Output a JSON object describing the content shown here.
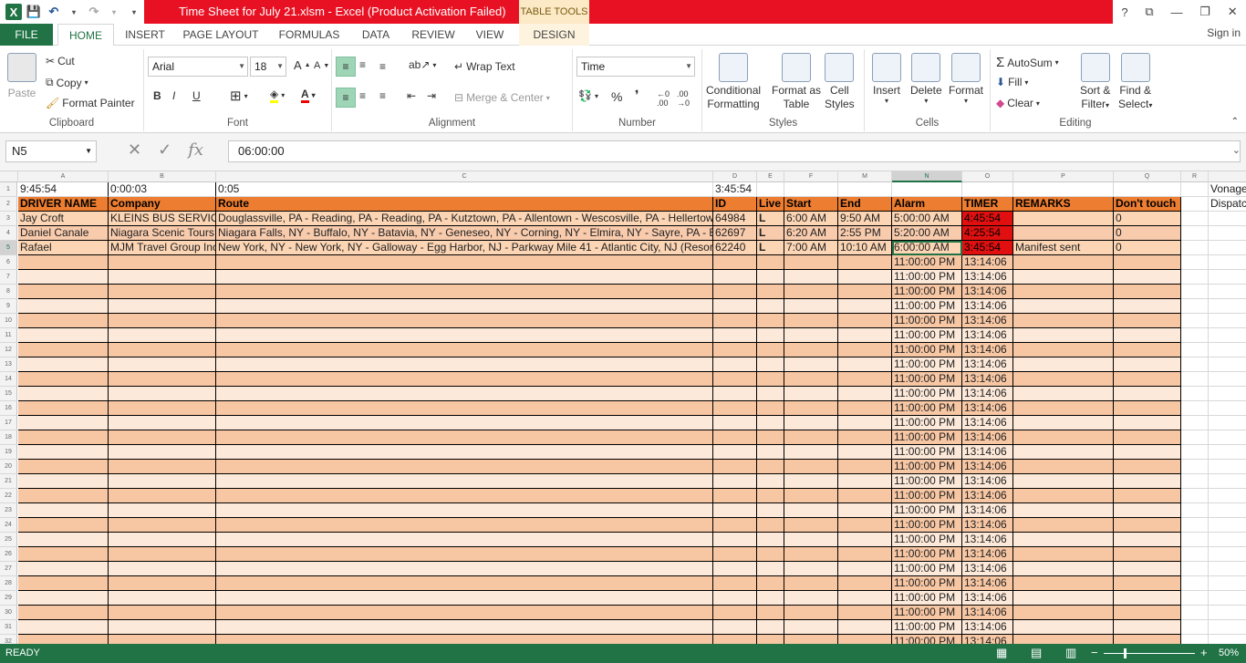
{
  "titlebar": {
    "title": "Time Sheet for July 21.xlsm -  Excel (Product Activation Failed)",
    "table_tools": "TABLE TOOLS",
    "help": "?",
    "restore_ribbon": "⧉",
    "minimize": "—",
    "maximize": "❐",
    "close": "✕"
  },
  "tabs": {
    "file": "FILE",
    "home": "HOME",
    "insert": "INSERT",
    "page_layout": "PAGE LAYOUT",
    "formulas": "FORMULAS",
    "data": "DATA",
    "review": "REVIEW",
    "view": "VIEW",
    "design": "DESIGN",
    "sign_in": "Sign in"
  },
  "ribbon": {
    "clipboard": {
      "paste": "Paste",
      "cut": "Cut",
      "copy": "Copy",
      "format_painter": "Format Painter",
      "title": "Clipboard"
    },
    "font": {
      "name": "Arial",
      "size": "18",
      "bold": "B",
      "italic": "I",
      "underline": "U",
      "title": "Font"
    },
    "alignment": {
      "wrap_text": "Wrap Text",
      "merge_center": "Merge & Center",
      "title": "Alignment"
    },
    "number": {
      "format": "Time",
      "percent": "%",
      "comma": "❜",
      "title": "Number"
    },
    "styles": {
      "conditional": "Conditional",
      "formatting": "Formatting",
      "format_as": "Format as",
      "table": "Table",
      "cell": "Cell",
      "styles_label": "Styles",
      "title": "Styles"
    },
    "cells": {
      "insert": "Insert",
      "delete": "Delete",
      "format": "Format",
      "title": "Cells"
    },
    "editing": {
      "autosum": "AutoSum",
      "fill": "Fill",
      "clear": "Clear",
      "sort_filter_1": "Sort &",
      "sort_filter_2": "Filter",
      "find_select_1": "Find &",
      "find_select_2": "Select",
      "title": "Editing"
    }
  },
  "formula_bar": {
    "name_box": "N5",
    "formula": "06:00:00"
  },
  "columns": [
    "A",
    "B",
    "C",
    "D",
    "E",
    "F",
    "M",
    "N",
    "O",
    "P",
    "Q",
    "R"
  ],
  "row1": {
    "a": "9:45:54",
    "b": "0:00:03",
    "c": "0:05",
    "d": "3:45:54",
    "s": "Vonage"
  },
  "headers": {
    "a": "DRIVER NAME",
    "b": "Company",
    "c": "Route",
    "d": "ID",
    "e": "Live",
    "f": "Start",
    "m": "End",
    "n": "Alarm",
    "o": "TIMER",
    "p": "REMARKS",
    "q": "Don't touch",
    "s": "Dispatc"
  },
  "rows": [
    {
      "a": "Jay Croft",
      "b": "KLEINS BUS SERVICE",
      "c": "Douglassville, PA - Reading, PA - Reading, PA - Kutztown, PA - Allentown - Wescosville, PA - Hellertown",
      "d": "64984",
      "e": "L",
      "f": "6:00 AM",
      "m": "9:50 AM",
      "n": "5:00:00 AM",
      "o": "4:45:54",
      "p": "",
      "q": "0"
    },
    {
      "a": "Daniel Canale",
      "b": "Niagara Scenic Tours",
      "c": "Niagara Falls, NY - Buffalo, NY - Batavia, NY - Geneseo, NY - Corning, NY - Elmira, NY - Sayre, PA - Binghamton",
      "d": "62697",
      "e": "L",
      "f": "6:20 AM",
      "m": "2:55 PM",
      "n": "5:20:00 AM",
      "o": "4:25:54",
      "p": "",
      "q": "0"
    },
    {
      "a": "Rafael",
      "b": "MJM Travel Group Inc",
      "c": "New York, NY - New York, NY - Galloway - Egg Harbor, NJ - Parkway Mile 41 - Atlantic City, NJ (Resorts)",
      "d": "62240",
      "e": "L",
      "f": "7:00 AM",
      "m": "10:10 AM",
      "n": "6:00:00 AM",
      "o": "3:45:54",
      "p": "Manifest sent",
      "q": "0"
    }
  ],
  "empty_alarm": "11:00:00 PM",
  "empty_timer": "13:14:06",
  "row_numbers": [
    "1",
    "2",
    "3",
    "4",
    "5",
    "6",
    "7",
    "8",
    "9",
    "10",
    "11",
    "12",
    "13",
    "14",
    "15",
    "16",
    "17",
    "18",
    "19",
    "20",
    "21",
    "22",
    "23",
    "24",
    "25",
    "26",
    "27",
    "28",
    "29",
    "30",
    "31",
    "32"
  ],
  "status": {
    "ready": "READY",
    "zoom": "50%"
  }
}
